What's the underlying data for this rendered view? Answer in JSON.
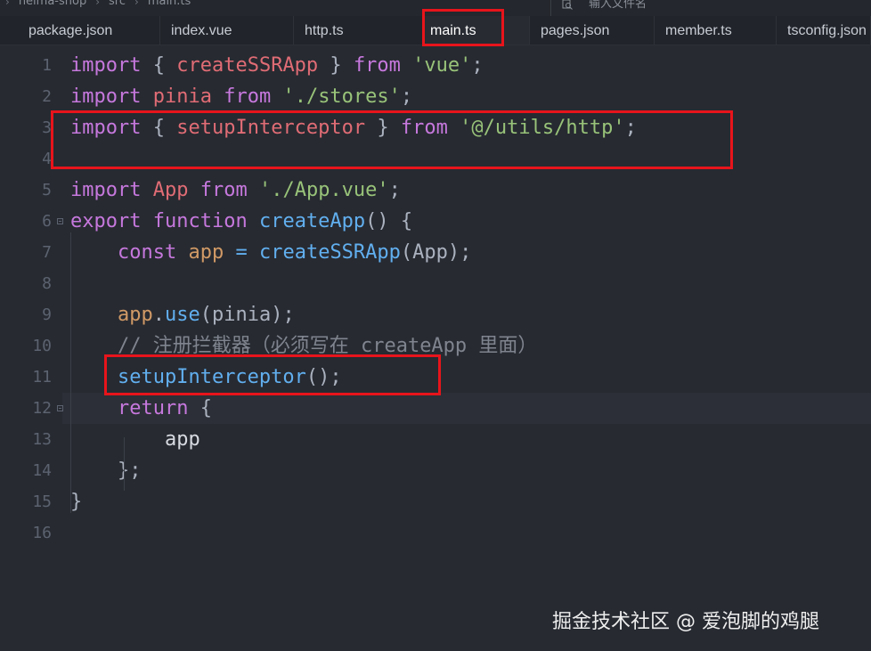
{
  "breadcrumb": [
    "heima-shop",
    "src",
    "main.ts"
  ],
  "search": {
    "placeholder": "输入文件名",
    "icon": "search-file-icon"
  },
  "tabs": [
    {
      "label": "package.json",
      "active": false
    },
    {
      "label": "index.vue",
      "active": false
    },
    {
      "label": "http.ts",
      "active": false
    },
    {
      "label": "main.ts",
      "active": true
    },
    {
      "label": "pages.json",
      "active": false
    },
    {
      "label": "member.ts",
      "active": false
    },
    {
      "label": "tsconfig.json",
      "active": false
    }
  ],
  "colors": {
    "keyword": "#c678dd",
    "identifier": "#e06c75",
    "string": "#98c379",
    "function": "#61afef",
    "variable": "#d19a66",
    "comment": "#7f848e",
    "annotation": "#e8141b",
    "background": "#272a31"
  },
  "code": [
    {
      "n": "1",
      "tokens": [
        [
          "kw",
          "import"
        ],
        [
          "pun",
          " { "
        ],
        [
          "id",
          "createSSRApp"
        ],
        [
          "pun",
          " } "
        ],
        [
          "kw",
          "from"
        ],
        [
          "pun",
          " "
        ],
        [
          "str",
          "'vue'"
        ],
        [
          "pun",
          ";"
        ]
      ]
    },
    {
      "n": "2",
      "tokens": [
        [
          "kw",
          "import"
        ],
        [
          "pun",
          " "
        ],
        [
          "id",
          "pinia"
        ],
        [
          "pun",
          " "
        ],
        [
          "kw",
          "from"
        ],
        [
          "pun",
          " "
        ],
        [
          "str",
          "'./stores'"
        ],
        [
          "pun",
          ";"
        ]
      ]
    },
    {
      "n": "3",
      "tokens": [
        [
          "kw",
          "import"
        ],
        [
          "pun",
          " { "
        ],
        [
          "id",
          "setupInterceptor"
        ],
        [
          "pun",
          " } "
        ],
        [
          "kw",
          "from"
        ],
        [
          "pun",
          " "
        ],
        [
          "str",
          "'@/utils/http'"
        ],
        [
          "pun",
          ";"
        ]
      ]
    },
    {
      "n": "4",
      "tokens": []
    },
    {
      "n": "5",
      "tokens": [
        [
          "kw",
          "import"
        ],
        [
          "pun",
          " "
        ],
        [
          "id",
          "App"
        ],
        [
          "pun",
          " "
        ],
        [
          "kw",
          "from"
        ],
        [
          "pun",
          " "
        ],
        [
          "str",
          "'./App.vue'"
        ],
        [
          "pun",
          ";"
        ]
      ]
    },
    {
      "n": "6",
      "tokens": [
        [
          "kw",
          "export"
        ],
        [
          "pun",
          " "
        ],
        [
          "kw",
          "function"
        ],
        [
          "pun",
          " "
        ],
        [
          "fn",
          "createApp"
        ],
        [
          "pun",
          "() {"
        ]
      ]
    },
    {
      "n": "7",
      "tokens": [
        [
          "pun",
          "    "
        ],
        [
          "kw",
          "const"
        ],
        [
          "pun",
          " "
        ],
        [
          "var",
          "app"
        ],
        [
          "pun",
          " "
        ],
        [
          "fn",
          "="
        ],
        [
          "pun",
          " "
        ],
        [
          "fn",
          "createSSRApp"
        ],
        [
          "pun",
          "(App);"
        ]
      ]
    },
    {
      "n": "8",
      "tokens": []
    },
    {
      "n": "9",
      "tokens": [
        [
          "pun",
          "    "
        ],
        [
          "var",
          "app"
        ],
        [
          "pun",
          "."
        ],
        [
          "fn",
          "use"
        ],
        [
          "pun",
          "(pinia);"
        ]
      ]
    },
    {
      "n": "10",
      "tokens": [
        [
          "pun",
          "    "
        ],
        [
          "cmt",
          "// 注册拦截器（必须写在 createApp 里面）"
        ]
      ]
    },
    {
      "n": "11",
      "tokens": [
        [
          "pun",
          "    "
        ],
        [
          "fn",
          "setupInterceptor"
        ],
        [
          "pun",
          "();"
        ]
      ]
    },
    {
      "n": "12",
      "tokens": [
        [
          "pun",
          "    "
        ],
        [
          "kw",
          "return"
        ],
        [
          "pun",
          " {"
        ]
      ]
    },
    {
      "n": "13",
      "tokens": [
        [
          "pun",
          "        "
        ],
        [
          "plain",
          "app"
        ]
      ]
    },
    {
      "n": "14",
      "tokens": [
        [
          "pun",
          "    };"
        ]
      ]
    },
    {
      "n": "15",
      "tokens": [
        [
          "pun",
          "}"
        ]
      ]
    },
    {
      "n": "16",
      "tokens": []
    }
  ],
  "watermark": "掘金技术社区 @ 爱泡脚的鸡腿"
}
